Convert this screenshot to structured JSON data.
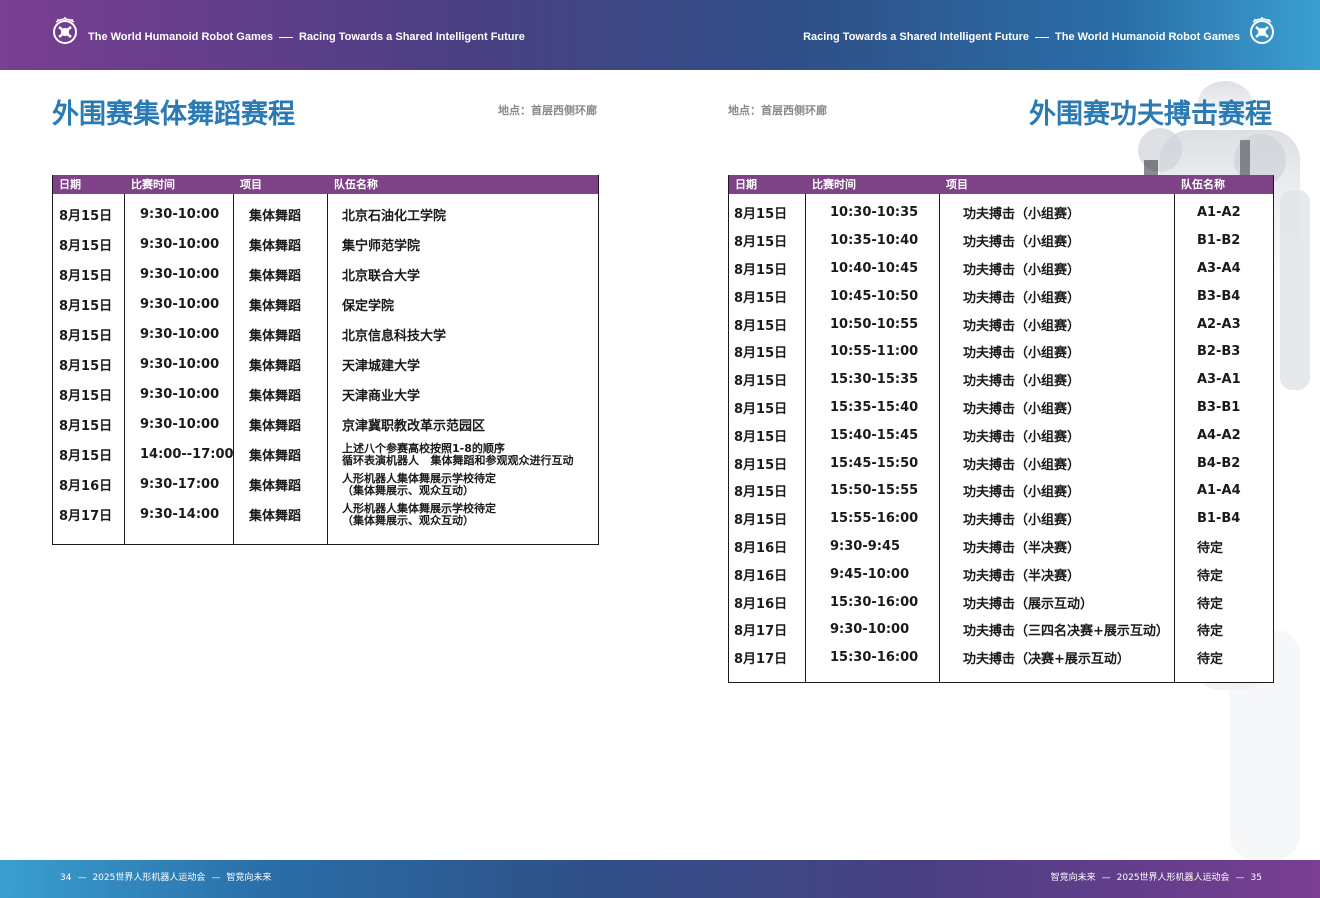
{
  "header": {
    "left_brand": "The World Humanoid Robot Games",
    "left_slogan": "Racing Towards a Shared Intelligent Future",
    "right_slogan": "Racing Towards a Shared Intelligent Future",
    "right_brand": "The World Humanoid Robot Games"
  },
  "left_page": {
    "title": "外围赛集体舞蹈赛程",
    "location": "地点：首层西侧环廊",
    "columns": [
      "日期",
      "比赛时间",
      "项目",
      "队伍名称"
    ],
    "rows": [
      {
        "date": "8月15日",
        "time": "9:30-10:00",
        "event": "集体舞蹈",
        "team": "北京石油化工学院"
      },
      {
        "date": "8月15日",
        "time": "9:30-10:00",
        "event": "集体舞蹈",
        "team": "集宁师范学院"
      },
      {
        "date": "8月15日",
        "time": "9:30-10:00",
        "event": "集体舞蹈",
        "team": "北京联合大学"
      },
      {
        "date": "8月15日",
        "time": "9:30-10:00",
        "event": "集体舞蹈",
        "team": "保定学院"
      },
      {
        "date": "8月15日",
        "time": "9:30-10:00",
        "event": "集体舞蹈",
        "team": "北京信息科技大学"
      },
      {
        "date": "8月15日",
        "time": "9:30-10:00",
        "event": "集体舞蹈",
        "team": "天津城建大学"
      },
      {
        "date": "8月15日",
        "time": "9:30-10:00",
        "event": "集体舞蹈",
        "team": "天津商业大学"
      },
      {
        "date": "8月15日",
        "time": "9:30-10:00",
        "event": "集体舞蹈",
        "team": "京津冀职教改革示范园区"
      },
      {
        "date": "8月15日",
        "time": "14:00--17:00",
        "event": "集体舞蹈",
        "team": "上述八个参赛高校按照1-8的顺序\n循环表演机器人   集体舞蹈和参观观众进行互动"
      },
      {
        "date": "8月16日",
        "time": "9:30-17:00",
        "event": "集体舞蹈",
        "team": "人形机器人集体舞展示学校待定\n（集体舞展示、观众互动）"
      },
      {
        "date": "8月17日",
        "time": "9:30-14:00",
        "event": "集体舞蹈",
        "team": "人形机器人集体舞展示学校待定\n（集体舞展示、观众互动）"
      }
    ]
  },
  "right_page": {
    "title": "外围赛功夫搏击赛程",
    "location": "地点：首层西侧环廊",
    "columns": [
      "日期",
      "比赛时间",
      "项目",
      "队伍名称"
    ],
    "rows": [
      {
        "date": "8月15日",
        "time": "10:30-10:35",
        "event": "功夫搏击（小组赛）",
        "team": "A1-A2"
      },
      {
        "date": "8月15日",
        "time": "10:35-10:40",
        "event": "功夫搏击（小组赛）",
        "team": "B1-B2"
      },
      {
        "date": "8月15日",
        "time": "10:40-10:45",
        "event": "功夫搏击（小组赛）",
        "team": "A3-A4"
      },
      {
        "date": "8月15日",
        "time": "10:45-10:50",
        "event": "功夫搏击（小组赛）",
        "team": "B3-B4"
      },
      {
        "date": "8月15日",
        "time": "10:50-10:55",
        "event": "功夫搏击（小组赛）",
        "team": "A2-A3"
      },
      {
        "date": "8月15日",
        "time": "10:55-11:00",
        "event": "功夫搏击（小组赛）",
        "team": "B2-B3"
      },
      {
        "date": "8月15日",
        "time": "15:30-15:35",
        "event": "功夫搏击（小组赛）",
        "team": "A3-A1"
      },
      {
        "date": "8月15日",
        "time": "15:35-15:40",
        "event": "功夫搏击（小组赛）",
        "team": "B3-B1"
      },
      {
        "date": "8月15日",
        "time": "15:40-15:45",
        "event": "功夫搏击（小组赛）",
        "team": "A4-A2"
      },
      {
        "date": "8月15日",
        "time": "15:45-15:50",
        "event": "功夫搏击（小组赛）",
        "team": "B4-B2"
      },
      {
        "date": "8月15日",
        "time": "15:50-15:55",
        "event": "功夫搏击（小组赛）",
        "team": "A1-A4"
      },
      {
        "date": "8月15日",
        "time": "15:55-16:00",
        "event": "功夫搏击（小组赛）",
        "team": "B1-B4"
      },
      {
        "date": "8月16日",
        "time": "9:30-9:45",
        "event": "功夫搏击（半决赛）",
        "team": "待定"
      },
      {
        "date": "8月16日",
        "time": "9:45-10:00",
        "event": "功夫搏击（半决赛）",
        "team": "待定"
      },
      {
        "date": "8月16日",
        "time": "15:30-16:00",
        "event": "功夫搏击（展示互动）",
        "team": "待定"
      },
      {
        "date": "8月17日",
        "time": "9:30-10:00",
        "event": "功夫搏击（三四名决赛+展示互动）",
        "team": "待定"
      },
      {
        "date": "8月17日",
        "time": "15:30-16:00",
        "event": "功夫搏击（决赛+展示互动）",
        "team": "待定"
      }
    ]
  },
  "footer": {
    "left_page_no": "34",
    "left_event": "2025世界人形机器人运动会",
    "left_slogan": "智竞向未来",
    "right_slogan": "智竞向未来",
    "right_event": "2025世界人形机器人运动会",
    "right_page_no": "35"
  },
  "colors": {
    "title": "#2a7ab3",
    "table_header": "#7d4386",
    "bar_purple": "#7a3e92",
    "bar_blue": "#3a9fd0"
  },
  "icons": {
    "logo": "world-humanoid-robot-games-logo"
  }
}
